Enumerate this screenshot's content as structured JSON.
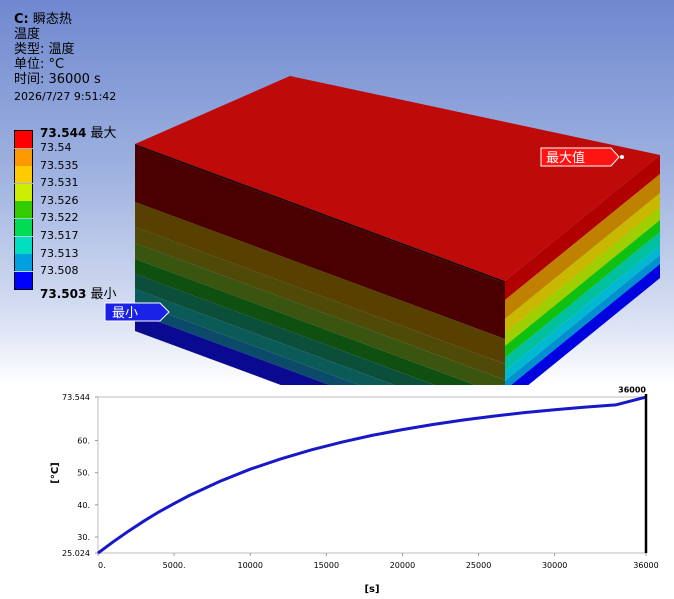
{
  "info": {
    "title_prefix": "C:",
    "title_name": "瞬态热",
    "result": "温度",
    "type_line": "类型: 温度",
    "unit_line": "单位: °C",
    "time_line": "时间: 36000 s",
    "date": "2026/7/27 9:51:42"
  },
  "legend": {
    "max_value": "73.544",
    "max_suffix": "最大",
    "min_value": "73.503",
    "min_suffix": "最小",
    "levels": [
      "73.54",
      "73.535",
      "73.531",
      "73.526",
      "73.522",
      "73.517",
      "73.513",
      "73.508"
    ],
    "colors": [
      "#ff0000",
      "#ff9900",
      "#ffcc00",
      "#ccee00",
      "#33cc00",
      "#00dd55",
      "#00e0c0",
      "#00a0e0",
      "#0000ff"
    ]
  },
  "probes": {
    "max_label": "最大值",
    "min_label": "最小"
  },
  "chart_data": {
    "type": "line",
    "x_unit_label": "[s]",
    "y_unit_label": "[°C]",
    "x_ticks": [
      "0.",
      "5000.",
      "10000",
      "15000",
      "20000",
      "25000",
      "30000",
      "36000"
    ],
    "y_ticks": [
      "25.024",
      "30.",
      "40.",
      "50.",
      "60.",
      "73.544"
    ],
    "y_tick_values": [
      25.024,
      30,
      40,
      50,
      60,
      73.544
    ],
    "marker_label": "36000",
    "xlim": [
      0,
      36000
    ],
    "ylim": [
      25.024,
      73.544
    ],
    "series": [
      {
        "color": "#1818c8",
        "x": [
          0,
          1000,
          2000,
          3000,
          4000,
          5000,
          6000,
          8000,
          10000,
          12000,
          14000,
          16000,
          18000,
          20000,
          22000,
          24000,
          26000,
          28000,
          30000,
          32000,
          34000,
          36000
        ],
        "y": [
          25.0,
          28.5,
          31.8,
          34.9,
          37.8,
          40.4,
          42.9,
          47.3,
          51.1,
          54.3,
          57.1,
          59.5,
          61.6,
          63.4,
          65.0,
          66.4,
          67.6,
          68.7,
          69.6,
          70.4,
          71.1,
          73.5
        ]
      }
    ]
  }
}
